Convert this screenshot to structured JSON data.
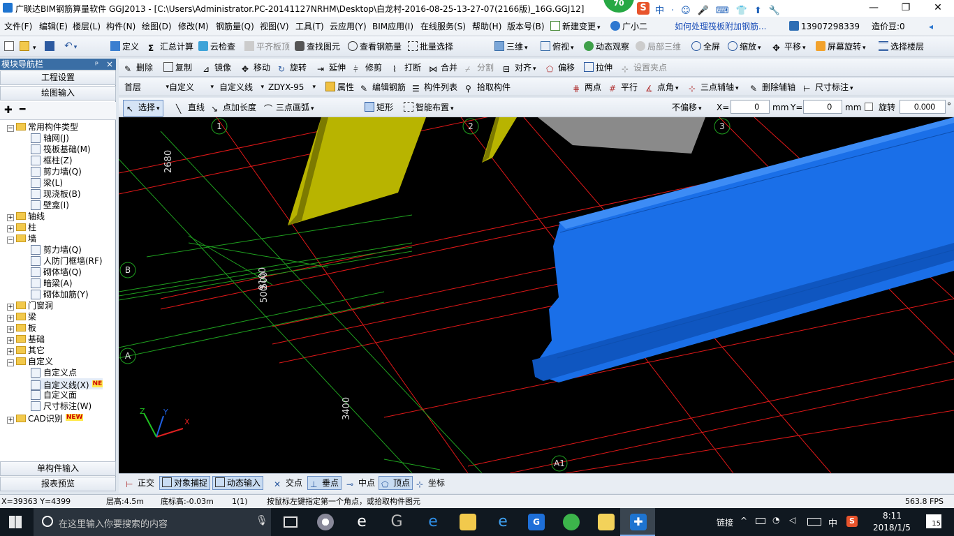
{
  "window": {
    "title": "广联达BIM钢筋算量软件 GGJ2013 - [C:\\Users\\Administrator.PC-20141127NRHM\\Desktop\\白龙村-2016-08-25-13-27-07(2166版)_16G.GGJ12]",
    "badge": "70",
    "minimize": "—",
    "maximize": "❐",
    "close": "✕",
    "ime": [
      "中",
      "·",
      "☺",
      "🎤",
      "⌨",
      "👕",
      "⬆",
      "🔧"
    ]
  },
  "menu": {
    "items": [
      "文件(F)",
      "编辑(E)",
      "楼层(L)",
      "构件(N)",
      "绘图(D)",
      "修改(M)",
      "钢筋量(Q)",
      "视图(V)",
      "工具(T)",
      "云应用(Y)",
      "BIM应用(I)",
      "在线服务(S)",
      "帮助(H)",
      "版本号(B)"
    ],
    "new_change": "新建变更",
    "assistant": "广小二",
    "help_link": "如何处理筏板附加钢筋...",
    "phone": "13907298339",
    "cost_beans": "造价豆:0"
  },
  "toolbar1": {
    "define": "定义",
    "sum_calc": "汇总计算",
    "cloud_check": "云检查",
    "flat_top": "平齐板顶",
    "find_elem": "查找图元",
    "view_rebar": "查看钢筋量",
    "batch_select": "批量选择",
    "view_3d": "三维",
    "top_view": "俯视",
    "dynamic_observe": "动态观察",
    "local_3d": "局部三维",
    "full_screen": "全屏",
    "zoom": "缩放",
    "pan": "平移",
    "screen_rotate": "屏幕旋转",
    "select_floor": "选择楼层"
  },
  "toolbar2": {
    "delete": "删除",
    "copy": "复制",
    "mirror": "镜像",
    "move": "移动",
    "rotate": "旋转",
    "extend": "延伸",
    "trim": "修剪",
    "break": "打断",
    "merge": "合并",
    "split": "分割",
    "align": "对齐",
    "offset": "偏移",
    "stretch": "拉伸",
    "set_grip": "设置夹点"
  },
  "toolbar3": {
    "floor": "首层",
    "category": "自定义",
    "type": "自定义线",
    "name": "ZDYX-95",
    "property": "属性",
    "edit_rebar": "编辑钢筋",
    "elem_list": "构件列表",
    "pick_elem": "拾取构件",
    "two_points": "两点",
    "parallel": "平行",
    "point_angle": "点角",
    "three_point_axis": "三点辅轴",
    "delete_axis": "删除辅轴",
    "dim": "尺寸标注"
  },
  "toolbar4": {
    "select": "选择",
    "line": "直线",
    "point_length": "点加长度",
    "three_point_arc": "三点画弧",
    "rect": "矩形",
    "smart_layout": "智能布置",
    "no_offset": "不偏移",
    "x_label": "X=",
    "x_value": "0",
    "y_label": "Y=",
    "y_value": "0",
    "mm1": "mm",
    "mm2": "mm",
    "rotate_label": "旋转",
    "rotate_value": "0.000",
    "deg": "°"
  },
  "nav": {
    "header": "模块导航栏",
    "pin": "ᵖ",
    "close": "×",
    "project_settings": "工程设置",
    "draw_input": "绘图输入",
    "tree": [
      {
        "label": "常用构件类型",
        "kind": "folder",
        "exp": "−",
        "indent": 0
      },
      {
        "label": "轴网(J)",
        "kind": "leaf",
        "indent": 1
      },
      {
        "label": "筏板基础(M)",
        "kind": "leaf",
        "indent": 1
      },
      {
        "label": "框柱(Z)",
        "kind": "leaf",
        "indent": 1
      },
      {
        "label": "剪力墙(Q)",
        "kind": "leaf",
        "indent": 1
      },
      {
        "label": "梁(L)",
        "kind": "leaf",
        "indent": 1
      },
      {
        "label": "现浇板(B)",
        "kind": "leaf",
        "indent": 1
      },
      {
        "label": "壁龛(I)",
        "kind": "leaf",
        "indent": 1
      },
      {
        "label": "轴线",
        "kind": "folder",
        "exp": "+",
        "indent": 0
      },
      {
        "label": "柱",
        "kind": "folder",
        "exp": "+",
        "indent": 0
      },
      {
        "label": "墙",
        "kind": "folder",
        "exp": "−",
        "indent": 0
      },
      {
        "label": "剪力墙(Q)",
        "kind": "leaf",
        "indent": 1
      },
      {
        "label": "人防门框墙(RF)",
        "kind": "leaf",
        "indent": 1
      },
      {
        "label": "砌体墙(Q)",
        "kind": "leaf",
        "indent": 1
      },
      {
        "label": "暗梁(A)",
        "kind": "leaf",
        "indent": 1
      },
      {
        "label": "砌体加筋(Y)",
        "kind": "leaf",
        "indent": 1
      },
      {
        "label": "门窗洞",
        "kind": "folder",
        "exp": "+",
        "indent": 0
      },
      {
        "label": "梁",
        "kind": "folder",
        "exp": "+",
        "indent": 0
      },
      {
        "label": "板",
        "kind": "folder",
        "exp": "+",
        "indent": 0
      },
      {
        "label": "基础",
        "kind": "folder",
        "exp": "+",
        "indent": 0
      },
      {
        "label": "其它",
        "kind": "folder",
        "exp": "+",
        "indent": 0
      },
      {
        "label": "自定义",
        "kind": "folder",
        "exp": "−",
        "indent": 0
      },
      {
        "label": "自定义点",
        "kind": "leaf",
        "indent": 1
      },
      {
        "label": "自定义线(X)",
        "kind": "leaf",
        "indent": 1,
        "badge": "NE"
      },
      {
        "label": "自定义面",
        "kind": "leaf",
        "indent": 1
      },
      {
        "label": "尺寸标注(W)",
        "kind": "leaf",
        "indent": 1
      },
      {
        "label": "CAD识别",
        "kind": "folder",
        "exp": "+",
        "indent": 0,
        "badge": "NEW"
      }
    ],
    "single_input": "单构件输入",
    "report_preview": "报表预览"
  },
  "canvas": {
    "axis_labels": {
      "a1": "1",
      "a2": "2",
      "a3": "3",
      "b": "B",
      "a": "A",
      "a1b": "A1"
    },
    "dims": {
      "d2680": "2680",
      "d500a": "500",
      "d500b": "500",
      "d9100": "9100",
      "d3400": "3400"
    },
    "colors": {
      "bg": "#000000",
      "blue_beam": "#1a6fe8",
      "yellow": "#b8b400",
      "grid_red": "#e01818",
      "grid_green": "#1fa01f",
      "gray": "#8a8a8a"
    }
  },
  "snapbar": {
    "ortho": "正交",
    "obj_snap": "对象捕捉",
    "dyn_input": "动态输入",
    "intersect": "交点",
    "perpendicular": "垂点",
    "midpoint": "中点",
    "vertex": "顶点",
    "coord": "坐标"
  },
  "status": {
    "coords": "X=39363 Y=4399",
    "floor_height": "层高:4.5m",
    "base_height": "底标高:-0.03m",
    "count": "1(1)",
    "hint": "按鼠标左键指定第一个角点，或拾取构件图元",
    "fps": "563.8 FPS"
  },
  "taskbar": {
    "search_placeholder": "在这里输入你要搜索的内容",
    "link": "链接",
    "ime": "中",
    "time": "8:11",
    "date": "2018/1/5",
    "notify": "15"
  }
}
